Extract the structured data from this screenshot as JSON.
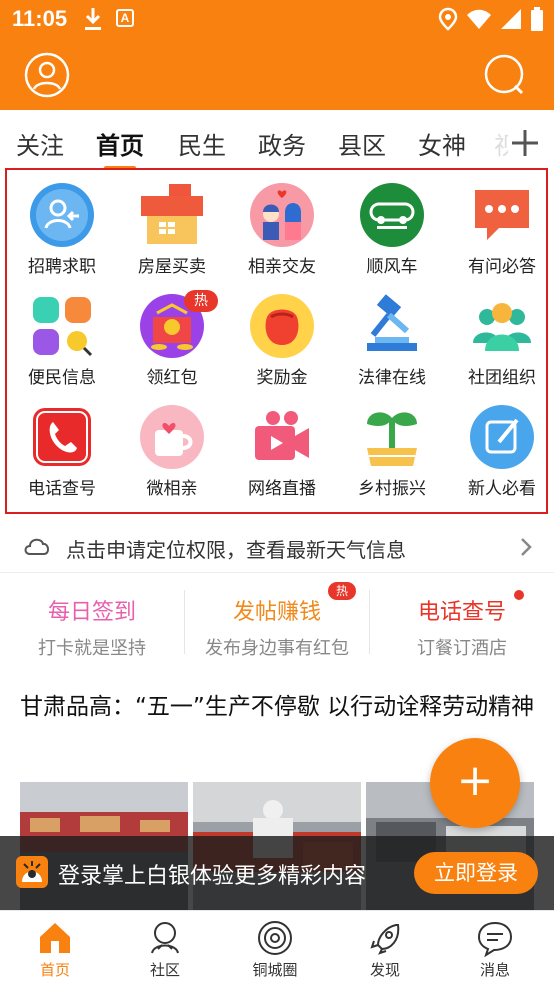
{
  "status_bar": {
    "time": "11:05",
    "app_icon_letter": "A"
  },
  "header": {
    "avatar_icon": "user-circle-icon",
    "search_icon": "search-icon"
  },
  "tabs": {
    "items": [
      "关注",
      "首页",
      "民生",
      "政务",
      "县区",
      "女神",
      "视"
    ],
    "active": "首页",
    "more_icon": "plus-icon"
  },
  "services": {
    "items": [
      {
        "label": "招聘求职",
        "icon": "recruit-icon"
      },
      {
        "label": "房屋买卖",
        "icon": "house-icon"
      },
      {
        "label": "相亲交友",
        "icon": "couple-icon"
      },
      {
        "label": "顺风车",
        "icon": "carpool-icon"
      },
      {
        "label": "有问必答",
        "icon": "chat-bubble-icon"
      },
      {
        "label": "便民信息",
        "icon": "blocks-search-icon"
      },
      {
        "label": "领红包",
        "icon": "red-envelope-icon"
      },
      {
        "label": "奖励金",
        "icon": "money-bag-icon"
      },
      {
        "label": "法律在线",
        "icon": "gavel-icon"
      },
      {
        "label": "社团组织",
        "icon": "group-icon"
      },
      {
        "label": "电话查号",
        "icon": "phone-icon"
      },
      {
        "label": "微相亲",
        "icon": "cup-heart-icon"
      },
      {
        "label": "网络直播",
        "icon": "video-camera-icon"
      },
      {
        "label": "乡村振兴",
        "icon": "sprout-icon"
      },
      {
        "label": "新人必看",
        "icon": "edit-note-icon"
      }
    ],
    "hot_badge": "热"
  },
  "weather": {
    "text": "点击申请定位权限，查看最新天气信息"
  },
  "quick_actions": [
    {
      "title": "每日签到",
      "subtitle": "打卡就是坚持",
      "color": "#e85fae"
    },
    {
      "title": "发帖赚钱",
      "subtitle": "发布身边事有红包",
      "color": "#f08a1c",
      "badge": "热"
    },
    {
      "title": "电话查号",
      "subtitle": "订餐订酒店",
      "color": "#e8372a"
    }
  ],
  "article": {
    "title": "甘肃品高：“五一”生产不停歇 以行动诠释劳动精神"
  },
  "fab": {
    "label": "+"
  },
  "login_bar": {
    "text": "登录掌上白银体验更多精彩内容",
    "button": "立即登录"
  },
  "bottom_nav": [
    {
      "label": "首页",
      "icon": "home-icon",
      "active": true
    },
    {
      "label": "社区",
      "icon": "community-icon"
    },
    {
      "label": "铜城圈",
      "icon": "circle-icon"
    },
    {
      "label": "发现",
      "icon": "rocket-icon"
    },
    {
      "label": "消息",
      "icon": "message-icon"
    }
  ],
  "colors": {
    "brand": "#f8810f",
    "highlight_border": "#d81e1e",
    "hot": "#e8372a"
  }
}
